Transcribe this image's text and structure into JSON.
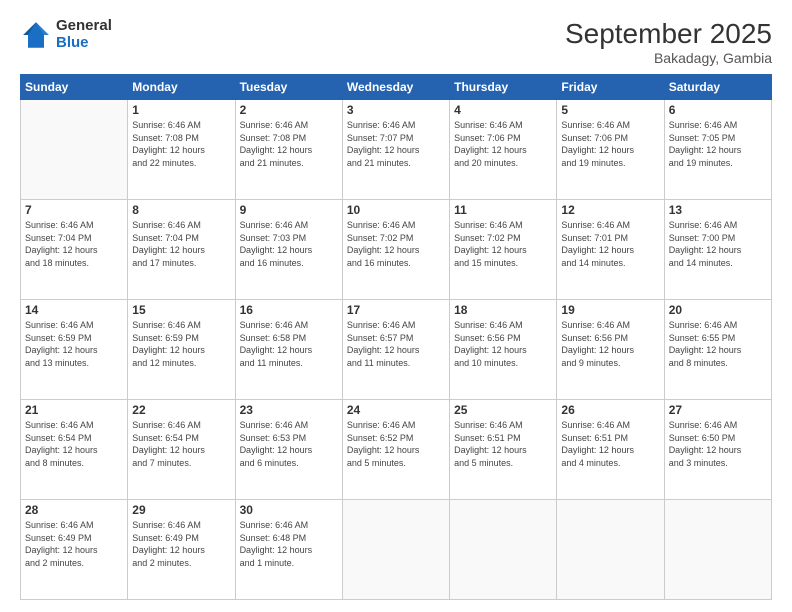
{
  "logo": {
    "general": "General",
    "blue": "Blue"
  },
  "header": {
    "title": "September 2025",
    "subtitle": "Bakadagy, Gambia"
  },
  "days": [
    "Sunday",
    "Monday",
    "Tuesday",
    "Wednesday",
    "Thursday",
    "Friday",
    "Saturday"
  ],
  "weeks": [
    [
      {
        "num": "",
        "info": ""
      },
      {
        "num": "1",
        "info": "Sunrise: 6:46 AM\nSunset: 7:08 PM\nDaylight: 12 hours\nand 22 minutes."
      },
      {
        "num": "2",
        "info": "Sunrise: 6:46 AM\nSunset: 7:08 PM\nDaylight: 12 hours\nand 21 minutes."
      },
      {
        "num": "3",
        "info": "Sunrise: 6:46 AM\nSunset: 7:07 PM\nDaylight: 12 hours\nand 21 minutes."
      },
      {
        "num": "4",
        "info": "Sunrise: 6:46 AM\nSunset: 7:06 PM\nDaylight: 12 hours\nand 20 minutes."
      },
      {
        "num": "5",
        "info": "Sunrise: 6:46 AM\nSunset: 7:06 PM\nDaylight: 12 hours\nand 19 minutes."
      },
      {
        "num": "6",
        "info": "Sunrise: 6:46 AM\nSunset: 7:05 PM\nDaylight: 12 hours\nand 19 minutes."
      }
    ],
    [
      {
        "num": "7",
        "info": "Sunrise: 6:46 AM\nSunset: 7:04 PM\nDaylight: 12 hours\nand 18 minutes."
      },
      {
        "num": "8",
        "info": "Sunrise: 6:46 AM\nSunset: 7:04 PM\nDaylight: 12 hours\nand 17 minutes."
      },
      {
        "num": "9",
        "info": "Sunrise: 6:46 AM\nSunset: 7:03 PM\nDaylight: 12 hours\nand 16 minutes."
      },
      {
        "num": "10",
        "info": "Sunrise: 6:46 AM\nSunset: 7:02 PM\nDaylight: 12 hours\nand 16 minutes."
      },
      {
        "num": "11",
        "info": "Sunrise: 6:46 AM\nSunset: 7:02 PM\nDaylight: 12 hours\nand 15 minutes."
      },
      {
        "num": "12",
        "info": "Sunrise: 6:46 AM\nSunset: 7:01 PM\nDaylight: 12 hours\nand 14 minutes."
      },
      {
        "num": "13",
        "info": "Sunrise: 6:46 AM\nSunset: 7:00 PM\nDaylight: 12 hours\nand 14 minutes."
      }
    ],
    [
      {
        "num": "14",
        "info": "Sunrise: 6:46 AM\nSunset: 6:59 PM\nDaylight: 12 hours\nand 13 minutes."
      },
      {
        "num": "15",
        "info": "Sunrise: 6:46 AM\nSunset: 6:59 PM\nDaylight: 12 hours\nand 12 minutes."
      },
      {
        "num": "16",
        "info": "Sunrise: 6:46 AM\nSunset: 6:58 PM\nDaylight: 12 hours\nand 11 minutes."
      },
      {
        "num": "17",
        "info": "Sunrise: 6:46 AM\nSunset: 6:57 PM\nDaylight: 12 hours\nand 11 minutes."
      },
      {
        "num": "18",
        "info": "Sunrise: 6:46 AM\nSunset: 6:56 PM\nDaylight: 12 hours\nand 10 minutes."
      },
      {
        "num": "19",
        "info": "Sunrise: 6:46 AM\nSunset: 6:56 PM\nDaylight: 12 hours\nand 9 minutes."
      },
      {
        "num": "20",
        "info": "Sunrise: 6:46 AM\nSunset: 6:55 PM\nDaylight: 12 hours\nand 8 minutes."
      }
    ],
    [
      {
        "num": "21",
        "info": "Sunrise: 6:46 AM\nSunset: 6:54 PM\nDaylight: 12 hours\nand 8 minutes."
      },
      {
        "num": "22",
        "info": "Sunrise: 6:46 AM\nSunset: 6:54 PM\nDaylight: 12 hours\nand 7 minutes."
      },
      {
        "num": "23",
        "info": "Sunrise: 6:46 AM\nSunset: 6:53 PM\nDaylight: 12 hours\nand 6 minutes."
      },
      {
        "num": "24",
        "info": "Sunrise: 6:46 AM\nSunset: 6:52 PM\nDaylight: 12 hours\nand 5 minutes."
      },
      {
        "num": "25",
        "info": "Sunrise: 6:46 AM\nSunset: 6:51 PM\nDaylight: 12 hours\nand 5 minutes."
      },
      {
        "num": "26",
        "info": "Sunrise: 6:46 AM\nSunset: 6:51 PM\nDaylight: 12 hours\nand 4 minutes."
      },
      {
        "num": "27",
        "info": "Sunrise: 6:46 AM\nSunset: 6:50 PM\nDaylight: 12 hours\nand 3 minutes."
      }
    ],
    [
      {
        "num": "28",
        "info": "Sunrise: 6:46 AM\nSunset: 6:49 PM\nDaylight: 12 hours\nand 2 minutes."
      },
      {
        "num": "29",
        "info": "Sunrise: 6:46 AM\nSunset: 6:49 PM\nDaylight: 12 hours\nand 2 minutes."
      },
      {
        "num": "30",
        "info": "Sunrise: 6:46 AM\nSunset: 6:48 PM\nDaylight: 12 hours\nand 1 minute."
      },
      {
        "num": "",
        "info": ""
      },
      {
        "num": "",
        "info": ""
      },
      {
        "num": "",
        "info": ""
      },
      {
        "num": "",
        "info": ""
      }
    ]
  ]
}
